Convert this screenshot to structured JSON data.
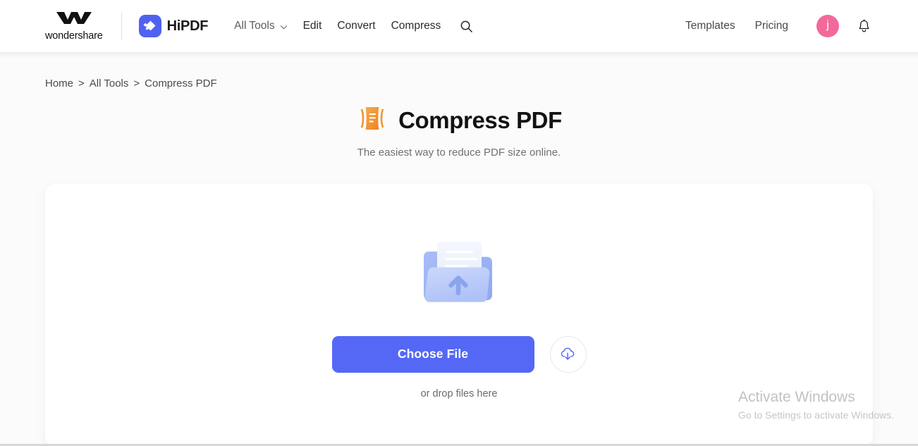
{
  "header": {
    "wondershare_label": "wondershare",
    "hipdf_label": "HiPDF",
    "nav": [
      {
        "label": "All Tools",
        "has_caret": true
      },
      {
        "label": "Edit",
        "has_caret": false
      },
      {
        "label": "Convert",
        "has_caret": false
      },
      {
        "label": "Compress",
        "has_caret": false
      }
    ],
    "search_icon": "search-icon",
    "right_nav": [
      {
        "label": "Templates"
      },
      {
        "label": "Pricing"
      }
    ],
    "avatar": {
      "initial": "j",
      "color": "#F4699B"
    },
    "bell_icon": "bell-icon"
  },
  "breadcrumb": {
    "items": [
      "Home",
      "All Tools",
      "Compress PDF"
    ],
    "separator": ">"
  },
  "hero": {
    "icon": "compress-pdf-icon",
    "title": "Compress PDF",
    "subtitle": "The easiest way to reduce PDF size online."
  },
  "upload": {
    "illustration": "folder-upload-illustration",
    "choose_file_label": "Choose File",
    "cloud_icon": "cloud-download-icon",
    "drop_hint": "or drop files here"
  },
  "watermark": {
    "title": "Activate Windows",
    "subtitle": "Go to Settings to activate Windows."
  },
  "colors": {
    "primary": "#5468F5",
    "brand_icon": "#5061F2",
    "accent_orange": "#F49434",
    "avatar_pink": "#F4699B"
  }
}
